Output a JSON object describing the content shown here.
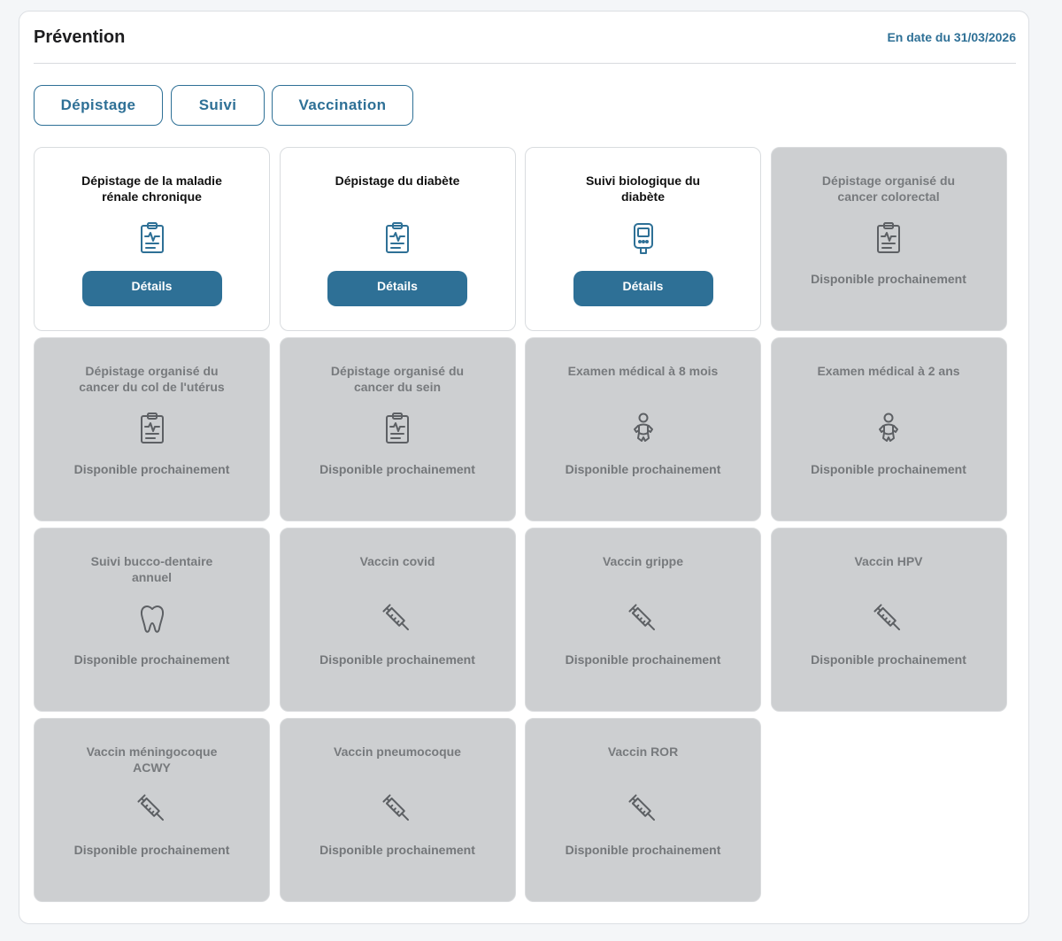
{
  "header": {
    "title": "Prévention",
    "date": "En date du 31/03/2026"
  },
  "tabs": [
    {
      "label": "Dépistage"
    },
    {
      "label": "Suivi"
    },
    {
      "label": "Vaccination"
    }
  ],
  "colors": {
    "accent": "#2e7096",
    "disabled_card": "#cdcfd1",
    "disabled_text": "#777a7d"
  },
  "cards": [
    {
      "title": "Dépistage de la maladie rénale chronique",
      "icon": "clipboard-pulse-icon",
      "active": true,
      "action": "Détails"
    },
    {
      "title": "Dépistage du diabète",
      "icon": "clipboard-pulse-icon",
      "active": true,
      "action": "Détails"
    },
    {
      "title": "Suivi biologique du diabète",
      "icon": "glucometer-icon",
      "active": true,
      "action": "Détails"
    },
    {
      "title": "Dépistage organisé du cancer colorectal",
      "icon": "clipboard-pulse-icon",
      "active": false,
      "status": "Disponible prochainement"
    },
    {
      "title": "Dépistage organisé du cancer du col de l'utérus",
      "icon": "clipboard-pulse-icon",
      "active": false,
      "status": "Disponible prochainement"
    },
    {
      "title": "Dépistage organisé du cancer du sein",
      "icon": "clipboard-pulse-icon",
      "active": false,
      "status": "Disponible prochainement"
    },
    {
      "title": "Examen médical à 8 mois",
      "icon": "baby-icon",
      "active": false,
      "status": "Disponible prochainement"
    },
    {
      "title": "Examen médical à 2 ans",
      "icon": "baby-icon",
      "active": false,
      "status": "Disponible prochainement"
    },
    {
      "title": "Suivi bucco-dentaire annuel",
      "icon": "tooth-icon",
      "active": false,
      "status": "Disponible prochainement"
    },
    {
      "title": "Vaccin covid",
      "icon": "syringe-icon",
      "active": false,
      "status": "Disponible prochainement"
    },
    {
      "title": "Vaccin grippe",
      "icon": "syringe-icon",
      "active": false,
      "status": "Disponible prochainement"
    },
    {
      "title": "Vaccin HPV",
      "icon": "syringe-icon",
      "active": false,
      "status": "Disponible prochainement"
    },
    {
      "title": "Vaccin méningocoque ACWY",
      "icon": "syringe-icon",
      "active": false,
      "status": "Disponible prochainement"
    },
    {
      "title": "Vaccin pneumocoque",
      "icon": "syringe-icon",
      "active": false,
      "status": "Disponible prochainement"
    },
    {
      "title": "Vaccin ROR",
      "icon": "syringe-icon",
      "active": false,
      "status": "Disponible prochainement"
    }
  ]
}
